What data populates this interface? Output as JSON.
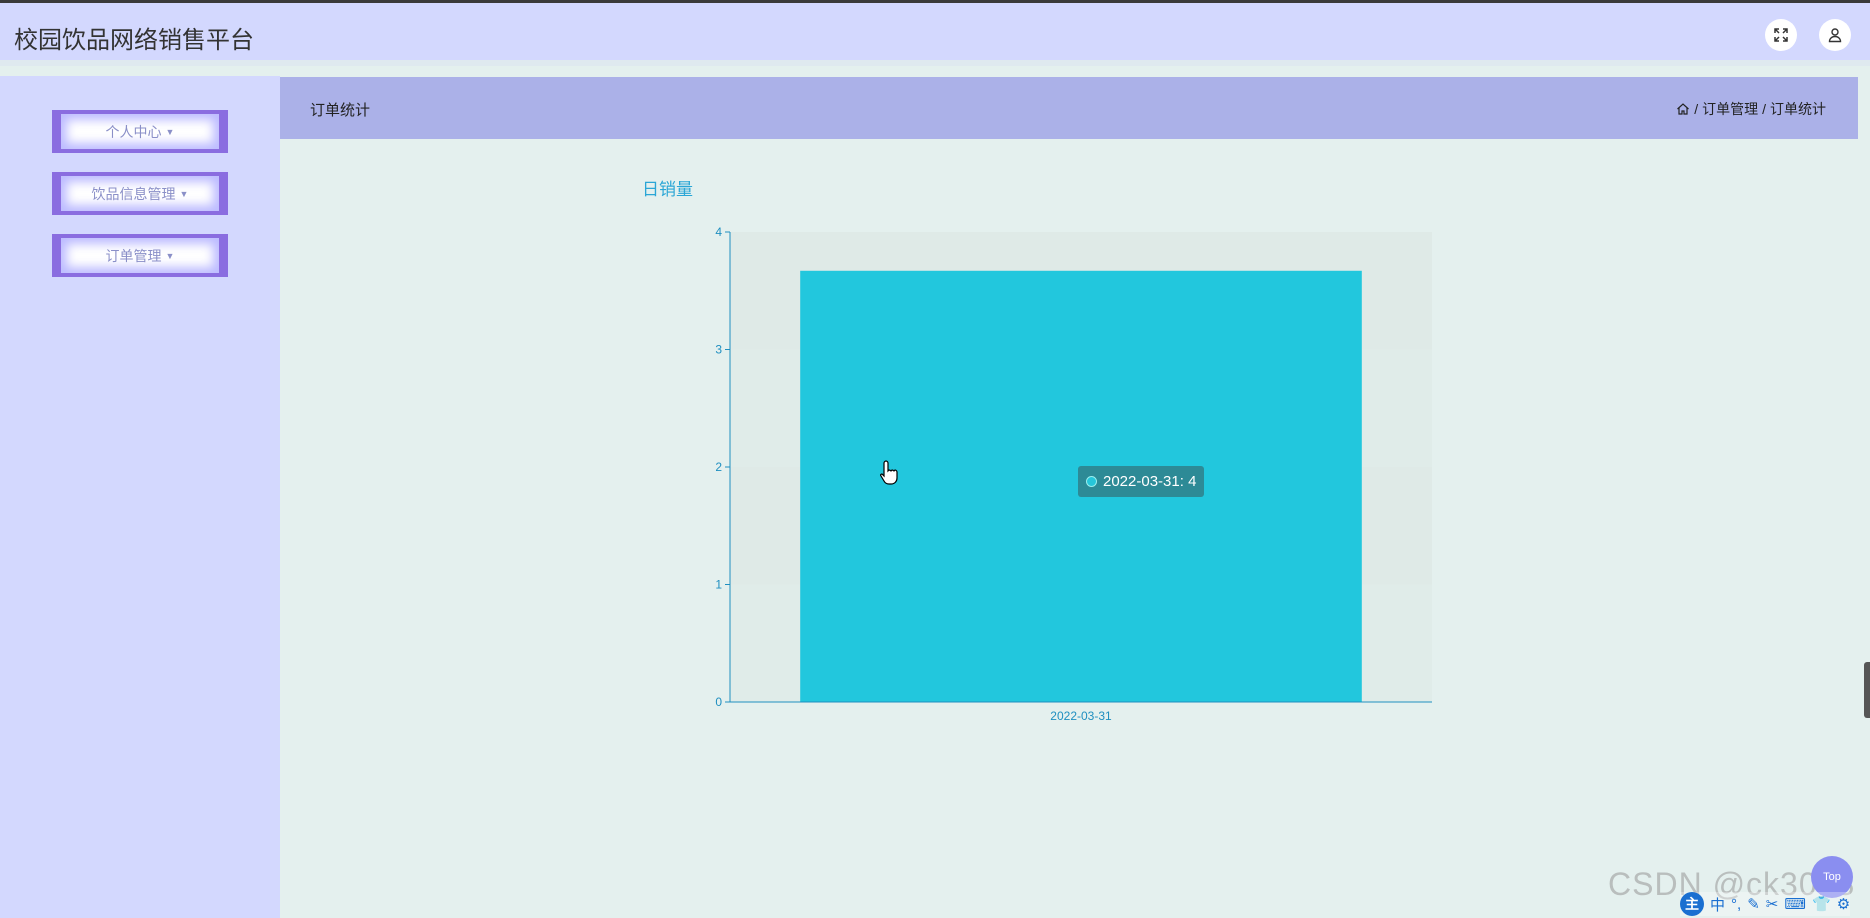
{
  "header": {
    "app_title": "校园饮品网络销售平台",
    "fullscreen_icon": "expand-icon",
    "user_icon": "user-icon"
  },
  "sidebar": {
    "items": [
      {
        "label": "个人中心"
      },
      {
        "label": "饮品信息管理"
      },
      {
        "label": "订单管理"
      }
    ]
  },
  "breadcrumb": {
    "page_title": "订单统计",
    "home_icon": "home-icon",
    "path": [
      "订单管理",
      "订单统计"
    ],
    "separator": "/"
  },
  "chart_title": "日销量",
  "chart_data": {
    "type": "bar",
    "categories": [
      "2022-03-31"
    ],
    "values": [
      3.67
    ],
    "ylim": [
      0,
      4
    ],
    "yticks": [
      0,
      1,
      2,
      3,
      4
    ],
    "grid": "alternating bands",
    "bar_color": "#22c7dd",
    "axis_color": "#1f8fc0"
  },
  "tooltip": {
    "text": "2022-03-31: 4"
  },
  "back_to_top_label": "Top",
  "watermark": "CSDN @ck3018",
  "ime": {
    "logo": "主",
    "mode": "中"
  }
}
